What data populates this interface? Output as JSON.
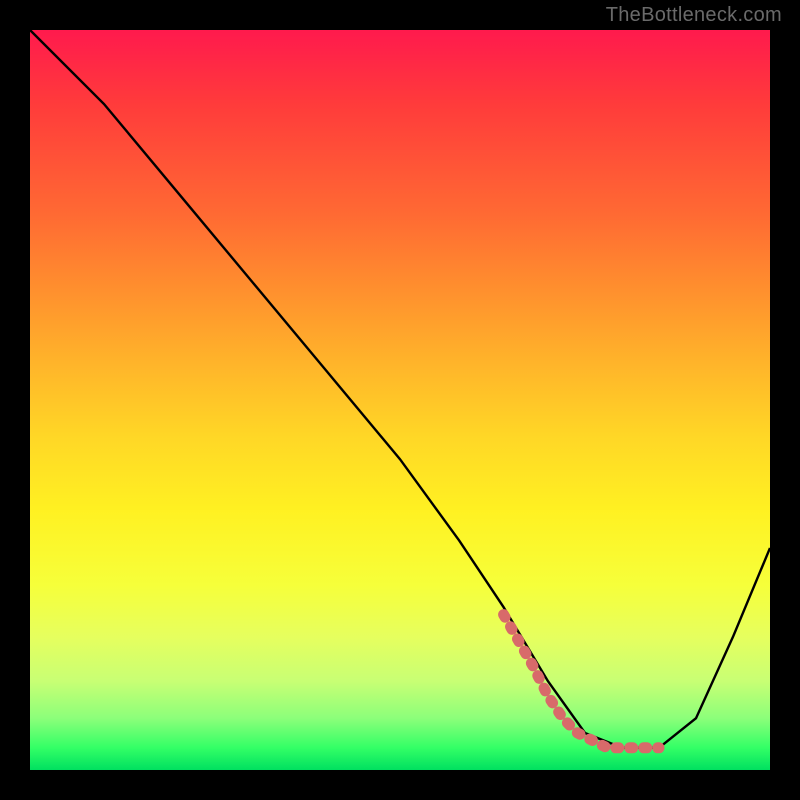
{
  "attribution": "TheBottleneck.com",
  "chart_data": {
    "type": "line",
    "title": "",
    "xlabel": "",
    "ylabel": "",
    "xlim": [
      0,
      100
    ],
    "ylim": [
      0,
      100
    ],
    "series": [
      {
        "name": "curve",
        "x": [
          0,
          10,
          20,
          30,
          40,
          50,
          58,
          64,
          70,
          75,
          80,
          85,
          90,
          95,
          100
        ],
        "values": [
          100,
          90,
          78,
          66,
          54,
          42,
          31,
          22,
          12,
          5,
          3,
          3,
          7,
          18,
          30
        ]
      }
    ],
    "annotations": [
      {
        "name": "trough-marker",
        "color": "#d86a6a",
        "x": [
          64,
          68,
          70,
          72,
          74,
          76,
          78,
          80,
          82,
          84,
          85
        ],
        "values": [
          21,
          14,
          10,
          7,
          5,
          4,
          3,
          3,
          3,
          3,
          3
        ]
      }
    ]
  }
}
